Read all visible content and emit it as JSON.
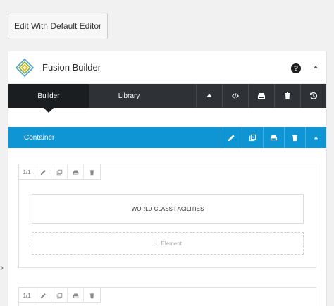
{
  "default_editor_button": "Edit With Default Editor",
  "panel": {
    "title": "Fusion Builder",
    "help_icon_glyph": "?"
  },
  "toolbar": {
    "tabs": [
      {
        "label": "Builder",
        "active": true
      },
      {
        "label": "Library",
        "active": false
      }
    ],
    "buttons": [
      "arrow-up-icon",
      "code-icon",
      "save-layout-icon",
      "trash-icon",
      "history-icon"
    ]
  },
  "container": {
    "label": "Container",
    "accent_color": "#0f95d3",
    "buttons": [
      "pencil-icon",
      "clone-icon",
      "save-icon",
      "trash-icon",
      "collapse-icon"
    ]
  },
  "columns": [
    {
      "size_label": "1/1",
      "element_label": "WORLD CLASS FACILITIES",
      "add_element_label": "Element"
    },
    {
      "size_label": "1/1"
    }
  ],
  "colors": {
    "toolbar_bg": "#2e3135",
    "toolbar_active": "#1b1e21",
    "container_bar": "#0f95d3"
  }
}
